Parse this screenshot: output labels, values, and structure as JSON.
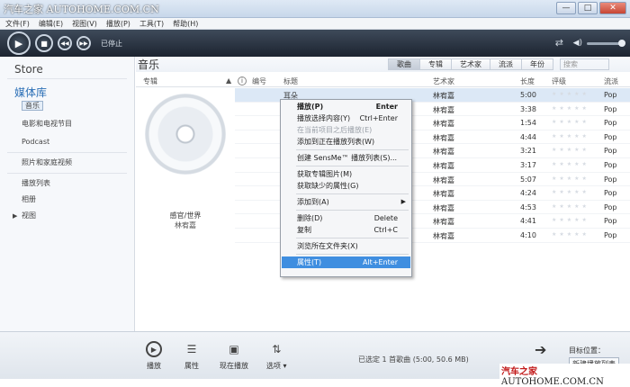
{
  "watermark_top": "汽车之家 AUTOHOME.COM.CN",
  "window": {
    "min": "—",
    "max": "□",
    "close": "✕"
  },
  "menu": [
    "文件(F)",
    "编辑(E)",
    "视图(V)",
    "播放(P)",
    "工具(T)",
    "帮助(H)"
  ],
  "player": {
    "status": "已停止"
  },
  "sidebar": {
    "store": "Store",
    "library": "媒体库",
    "items": [
      {
        "label": "音乐"
      },
      {
        "label": "电影和电视节目"
      },
      {
        "label": "Podcast"
      },
      {
        "label": "照片和家庭视频"
      },
      {
        "label": "播放列表"
      },
      {
        "label": "相册"
      },
      {
        "label": "视图"
      }
    ]
  },
  "main": {
    "title": "音乐",
    "views": [
      "歌曲",
      "专辑",
      "艺术家",
      "流派",
      "年份"
    ],
    "search_placeholder": "搜索",
    "columns": {
      "album": "专辑",
      "info": "i",
      "track": "编号",
      "title": "标题",
      "artist": "艺术家",
      "length": "长度",
      "rating": "评级",
      "genre": "流派"
    },
    "album": {
      "title": "感官/世界",
      "artist": "林宥嘉"
    },
    "rows": [
      {
        "title": "耳朵",
        "artist": "林宥嘉",
        "length": "5:00",
        "genre": "Pop"
      },
      {
        "title": "",
        "artist": "林宥嘉",
        "length": "3:38",
        "genre": "Pop"
      },
      {
        "title": "",
        "artist": "林宥嘉",
        "length": "1:54",
        "genre": "Pop"
      },
      {
        "title": "",
        "artist": "林宥嘉",
        "length": "4:44",
        "genre": "Pop"
      },
      {
        "title": "",
        "artist": "林宥嘉",
        "length": "3:21",
        "genre": "Pop"
      },
      {
        "title": "",
        "artist": "林宥嘉",
        "length": "3:17",
        "genre": "Pop"
      },
      {
        "title": "",
        "artist": "林宥嘉",
        "length": "5:07",
        "genre": "Pop"
      },
      {
        "title": "",
        "artist": "林宥嘉",
        "length": "4:24",
        "genre": "Pop"
      },
      {
        "title": "",
        "artist": "林宥嘉",
        "length": "4:53",
        "genre": "Pop"
      },
      {
        "title": "",
        "artist": "林宥嘉",
        "length": "4:41",
        "genre": "Pop"
      },
      {
        "title": "",
        "artist": "林宥嘉",
        "length": "4:10",
        "genre": "Pop"
      }
    ]
  },
  "context_menu": {
    "items": [
      {
        "label": "播放(P)",
        "shortcut": "Enter"
      },
      {
        "label": "播放选择内容(Y)",
        "shortcut": "Ctrl+Enter"
      },
      {
        "label": "在当前项目之后播放(E)",
        "shortcut": ""
      },
      {
        "label": "添加到正在播放列表(W)",
        "shortcut": ""
      },
      {
        "label": "创建 SensMe™ 播放列表(S)...",
        "shortcut": ""
      },
      {
        "label": "获取专辑图片(M)",
        "shortcut": ""
      },
      {
        "label": "获取缺少的属性(G)",
        "shortcut": ""
      },
      {
        "label": "添加到(A)",
        "shortcut": ""
      },
      {
        "label": "删除(D)",
        "shortcut": "Delete"
      },
      {
        "label": "复制",
        "shortcut": "Ctrl+C"
      },
      {
        "label": "浏览所在文件夹(X)",
        "shortcut": ""
      },
      {
        "label": "属性(T)",
        "shortcut": "Alt+Enter"
      }
    ]
  },
  "bottom": {
    "tools": [
      {
        "label": "播放",
        "icon": "play-icon"
      },
      {
        "label": "属性",
        "icon": "properties-icon"
      },
      {
        "label": "现在播放",
        "icon": "now-playing-icon"
      },
      {
        "label": "选项",
        "icon": "options-icon"
      }
    ],
    "selection_info": "已选定 1 首歌曲 (5:00, 50.6 MB)",
    "target_label": "目标位置：",
    "new_playlist": "新建播放列表"
  },
  "watermark_bottom": {
    "brand": "汽车之家",
    "domain": "AUTOHOME.COM.CN"
  }
}
